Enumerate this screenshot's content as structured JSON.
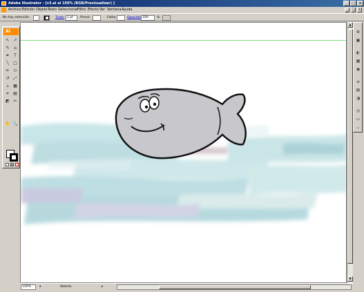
{
  "window": {
    "title": "Adobe Illustrator - [v3.ai al 150% (RGB/Previsualizar) ]",
    "minimize": "_",
    "maximize": "□",
    "close": "×"
  },
  "menu": [
    "Archivo",
    "Edición",
    "Objeto",
    "Texto",
    "Seleccionar",
    "Filtro",
    "Efecto",
    "Ver",
    "Ventana",
    "Ayuda"
  ],
  "control": {
    "selection": "No hay selección",
    "stroke_label": "Trazo:",
    "stroke_weight": "1 pt",
    "brush_label": "Pincel:",
    "style_label": "Estilo:",
    "opacity_label": "Opacidad:",
    "opacity_value": "100",
    "percent": "%"
  },
  "toolbox": {
    "badge": "Ai",
    "tools": [
      "↖",
      "↗",
      "✎",
      "⌂",
      "✒",
      "T",
      "╲",
      "□",
      "✏",
      "⬭",
      "↺",
      "⤢",
      "⟂",
      "▦",
      "⌗",
      "▤",
      "◩",
      "✂",
      "✋",
      "🔍"
    ]
  },
  "status": {
    "zoom": "150%",
    "state": "Abierto"
  },
  "colors": {
    "accent": "#ff8c00",
    "fish_fill": "#c8c8cc",
    "water": "#a9d4da"
  }
}
